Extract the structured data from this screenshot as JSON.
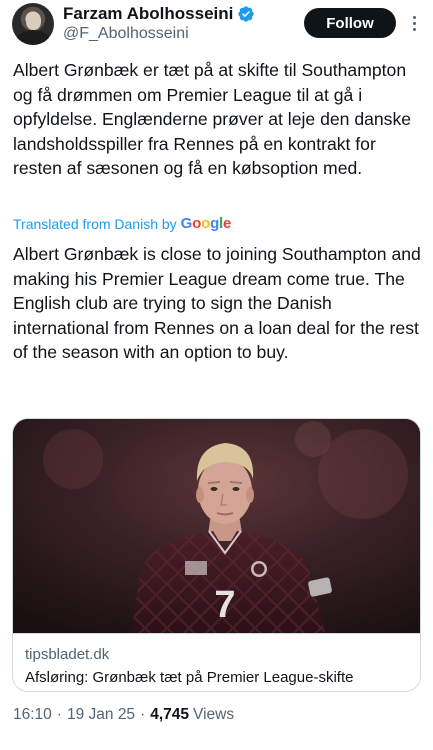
{
  "author": {
    "name": "Farzam Abolhosseini",
    "handle": "@F_Abolhosseini",
    "verified_color": "#1d9bf0"
  },
  "actions": {
    "follow_label": "Follow",
    "more_icon": "more-vertical-icon"
  },
  "tweet": {
    "text": "Albert Grønbæk er tæt på at skifte til Southampton og få drømmen om Premier League til at gå i opfyldelse. Englænderne prøver at leje den danske landsholdsspiller fra Rennes på en kontrakt for resten af sæsonen og få en købsoption med.",
    "translated_label": "Translated from Danish by",
    "translator": "Google",
    "translation": "Albert Grønbæk is close to joining Southampton and making his Premier League dream come true. The English club are trying to sign the Danish international from Rennes on a loan deal for the rest of the season with an option to buy."
  },
  "card": {
    "domain": "tipsbladet.dk",
    "title": "Afsløring: Grønbæk tæt på Premier League-skifte",
    "jersey_number": "7"
  },
  "meta": {
    "time": "16:10",
    "date": "19 Jan 25",
    "views_count": "4,745",
    "views_label": "Views",
    "separator": "·"
  }
}
